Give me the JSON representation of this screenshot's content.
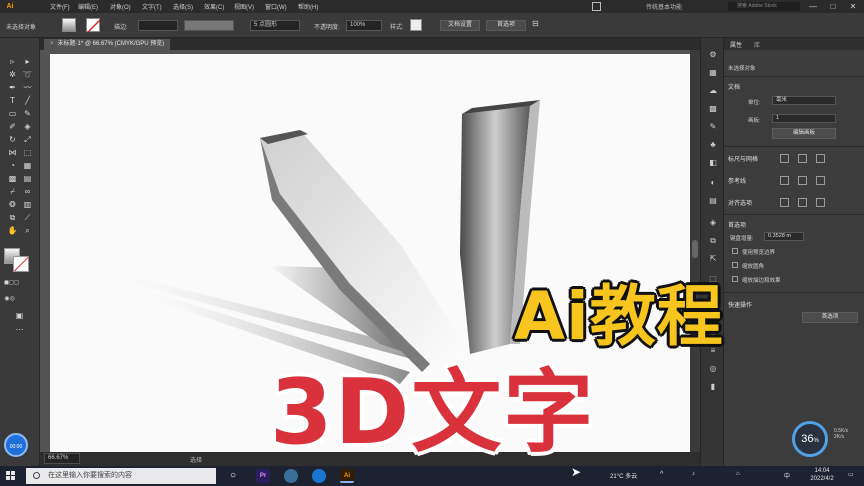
{
  "menubar": {
    "logo": "Ai",
    "items": [
      "文件(F)",
      "编辑(E)",
      "对象(O)",
      "文字(T)",
      "选择(S)",
      "效果(C)",
      "视图(V)",
      "窗口(W)",
      "帮助(H)"
    ],
    "workspace": "传统基本功能",
    "search_placeholder": "搜索 Adobe Stock",
    "min": "—",
    "max": "□",
    "close": "✕"
  },
  "controlbar": {
    "selection": "未选择对象",
    "stroke_label": "描边:",
    "brush_label": "5 点圆形",
    "opacity_label": "不透明度:",
    "opacity_value": "100%",
    "style_label": "样式:",
    "doc_setup": "文档设置",
    "preferences": "首选项"
  },
  "tab": {
    "title": "未标题-1* @ 66.67% (CMYK/GPU 预览)",
    "close": "×"
  },
  "statusbar": {
    "zoom": "66.67%",
    "status": "选择"
  },
  "panel": {
    "tabs": [
      "属性",
      "库"
    ],
    "no_selection": "未选择对象",
    "document": "文档",
    "units_label": "单位:",
    "units_value": "毫米",
    "artboard_label": "画板:",
    "artboard_value": "1",
    "edit_artboard": "编辑画板",
    "rulers_grid": "标尺与网格",
    "guides": "参考线",
    "snap": "对齐选项",
    "preferences_section": "首选项",
    "keyboard_increment_label": "键盘增量:",
    "keyboard_increment_value": "0.3528 m",
    "preview_bounds": "使用预览边界",
    "scale_corners": "缩放圆角",
    "scale_strokes": "缩放描边和效果",
    "quick_actions": "快速操作",
    "preferences_btn": "首选项"
  },
  "overlay": {
    "ai_title": "Ai教程",
    "main_title": "3D文字"
  },
  "widgets": {
    "cam_badge": "00:00",
    "gauge_value": "36",
    "gauge_unit": "%",
    "gauge_side_top": "0.5K/s",
    "gauge_side_bottom": "2K/s"
  },
  "taskbar": {
    "search_placeholder": "在这里输入你要搜索的内容",
    "apps": [
      {
        "name": "Pr",
        "color": "#2a1d5c"
      },
      {
        "name": "Ai",
        "color": "#331d00"
      }
    ],
    "weather": "21°C 多云",
    "ime": "中",
    "time": "14:04",
    "date": "2022/4/2"
  },
  "colors": {
    "accent": "#f7c51e",
    "title_red": "#d9323c",
    "ai_orange": "#ff9a00"
  }
}
